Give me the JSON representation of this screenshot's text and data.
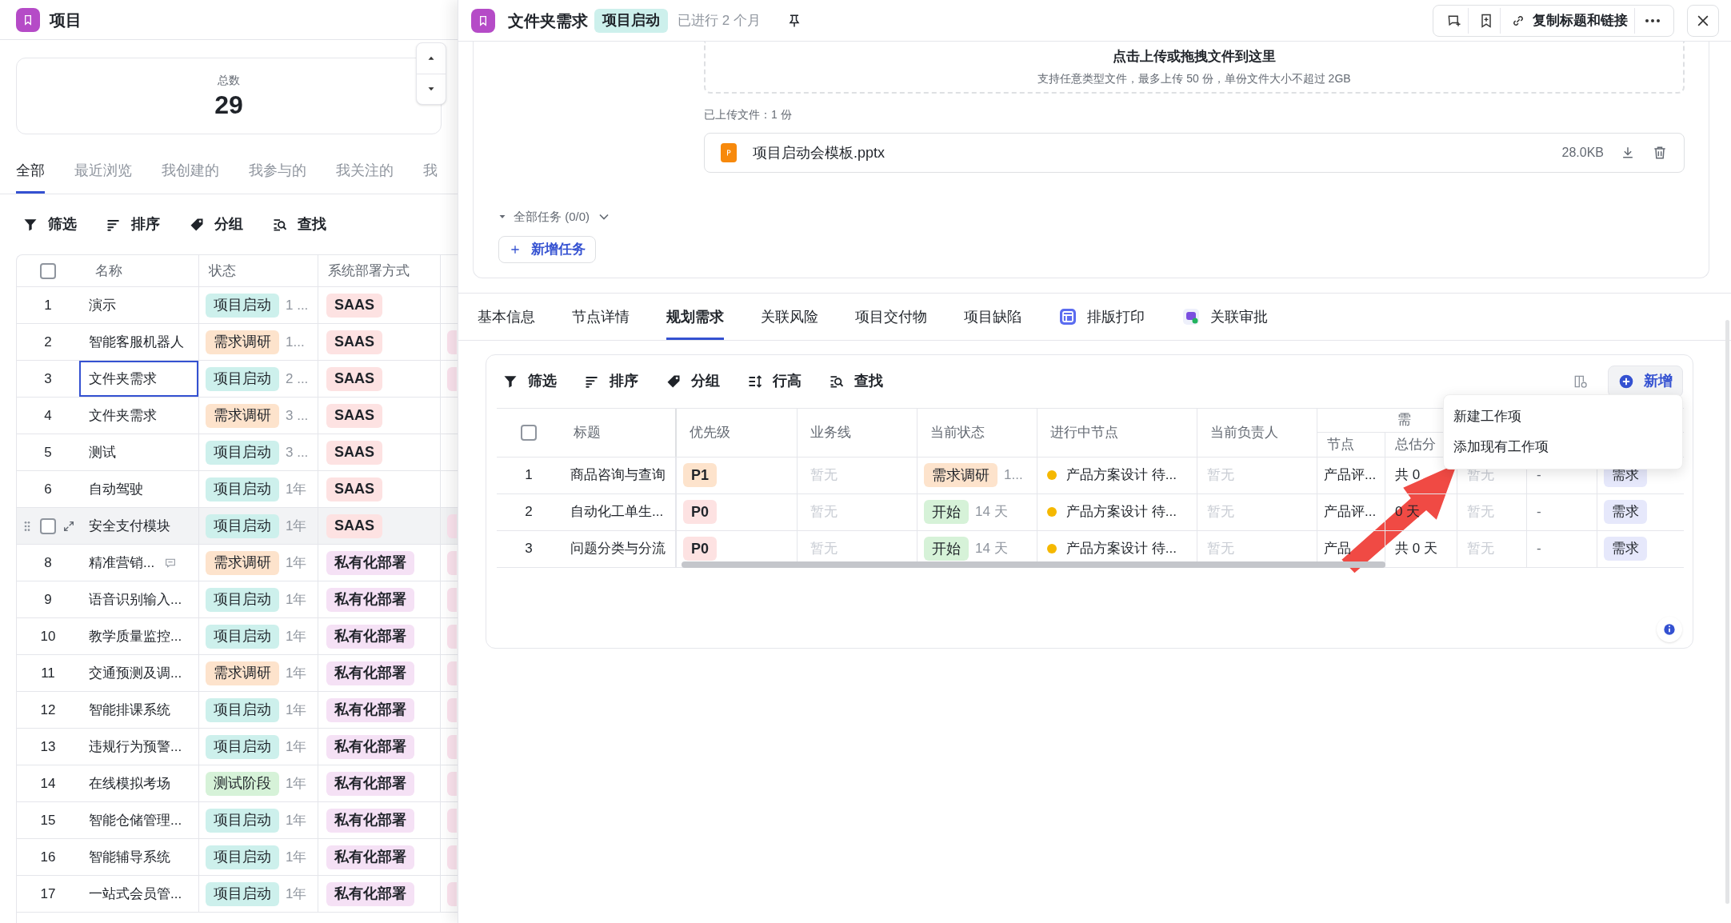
{
  "app": {
    "title": "项目"
  },
  "summary": {
    "label": "总数",
    "value": "29"
  },
  "list_tabs": [
    {
      "label": "全部",
      "selected": true
    },
    {
      "label": "最近浏览",
      "selected": false
    },
    {
      "label": "我创建的",
      "selected": false
    },
    {
      "label": "我参与的",
      "selected": false
    },
    {
      "label": "我关注的",
      "selected": false
    },
    {
      "label": "我",
      "selected": false
    }
  ],
  "left_toolbar": [
    {
      "kind": "filter",
      "label": "筛选"
    },
    {
      "kind": "sort",
      "label": "排序"
    },
    {
      "kind": "group",
      "label": "分组"
    },
    {
      "kind": "find",
      "label": "查找"
    }
  ],
  "project_table": {
    "select_all_checked": false,
    "columns": [
      "名称",
      "状态",
      "系统部署方式"
    ],
    "rows": [
      {
        "index": "1",
        "name": "演示",
        "status": {
          "label": "项目启动",
          "color": "#cdf0ec"
        },
        "duration": "1 ...",
        "deployment": {
          "label": "SAAS",
          "color": "#fde2e2"
        }
      },
      {
        "index": "2",
        "name": "智能客服机器人",
        "status": {
          "label": "需求调研",
          "color": "#fde3cc"
        },
        "duration": "1...",
        "deployment": {
          "label": "SAAS",
          "color": "#fde2e2"
        },
        "column_4": {
          "kind": "tag"
        }
      },
      {
        "index": "3",
        "name": "文件夹需求",
        "focused": true,
        "status": {
          "label": "项目启动",
          "color": "#cdf0ec"
        },
        "duration": "2 ...",
        "deployment": {
          "label": "SAAS",
          "color": "#fde2e2"
        },
        "column_4": {
          "kind": "tag"
        }
      },
      {
        "index": "4",
        "name": "文件夹需求",
        "status": {
          "label": "需求调研",
          "color": "#fde3cc"
        },
        "duration": "3 ...",
        "deployment": {
          "label": "SAAS",
          "color": "#fde2e2"
        }
      },
      {
        "index": "5",
        "name": "测试",
        "status": {
          "label": "项目启动",
          "color": "#cdf0ec"
        },
        "duration": "3 ...",
        "deployment": {
          "label": "SAAS",
          "color": "#fde2e2"
        }
      },
      {
        "index": "6",
        "name": "自动驾驶",
        "status": {
          "label": "项目启动",
          "color": "#cdf0ec"
        },
        "duration": "1年",
        "deployment": {
          "label": "SAAS",
          "color": "#fde2e2"
        }
      },
      {
        "hovered": true,
        "checked": false,
        "name": "安全支付模块",
        "status": {
          "label": "项目启动",
          "color": "#cdf0ec"
        },
        "duration": "1年",
        "deployment": {
          "label": "SAAS",
          "color": "#fde2e2"
        },
        "column_4": {
          "kind": "tag"
        }
      },
      {
        "index": "8",
        "name": "精准营销...",
        "comment": true,
        "status": {
          "label": "需求调研",
          "color": "#fde3cc"
        },
        "duration": "1年",
        "deployment": {
          "label": "私有化部署",
          "color": "#f5e1f5"
        },
        "column_4": {
          "kind": "tag"
        }
      },
      {
        "index": "9",
        "name": "语音识别输入...",
        "status": {
          "label": "项目启动",
          "color": "#cdf0ec"
        },
        "duration": "1年",
        "deployment": {
          "label": "私有化部署",
          "color": "#f5e1f5"
        },
        "column_4": {
          "kind": "tag"
        }
      },
      {
        "index": "10",
        "name": "教学质量监控...",
        "status": {
          "label": "项目启动",
          "color": "#cdf0ec"
        },
        "duration": "1年",
        "deployment": {
          "label": "私有化部署",
          "color": "#f5e1f5"
        },
        "column_4": {
          "kind": "tag"
        }
      },
      {
        "index": "11",
        "name": "交通预测及调...",
        "status": {
          "label": "需求调研",
          "color": "#fde3cc"
        },
        "duration": "1年",
        "deployment": {
          "label": "私有化部署",
          "color": "#f5e1f5"
        },
        "column_4": {
          "kind": "tag"
        }
      },
      {
        "index": "12",
        "name": "智能排课系统",
        "status": {
          "label": "项目启动",
          "color": "#cdf0ec"
        },
        "duration": "1年",
        "deployment": {
          "label": "私有化部署",
          "color": "#f5e1f5"
        },
        "column_4": {
          "kind": "tag"
        }
      },
      {
        "index": "13",
        "name": "违规行为预警...",
        "status": {
          "label": "项目启动",
          "color": "#cdf0ec"
        },
        "duration": "1年",
        "deployment": {
          "label": "私有化部署",
          "color": "#f5e1f5"
        },
        "column_4": {
          "kind": "tag"
        }
      },
      {
        "index": "14",
        "name": "在线模拟考场",
        "status": {
          "label": "测试阶段",
          "color": "#d6f2d8"
        },
        "duration": "1年",
        "deployment": {
          "label": "私有化部署",
          "color": "#f5e1f5"
        },
        "column_4": {
          "kind": "tag"
        }
      },
      {
        "index": "15",
        "name": "智能仓储管理...",
        "status": {
          "label": "项目启动",
          "color": "#cdf0ec"
        },
        "duration": "1年",
        "deployment": {
          "label": "私有化部署",
          "color": "#f5e1f5"
        },
        "column_4": {
          "kind": "tag"
        }
      },
      {
        "index": "16",
        "name": "智能辅导系统",
        "status": {
          "label": "项目启动",
          "color": "#cdf0ec"
        },
        "duration": "1年",
        "deployment": {
          "label": "私有化部署",
          "color": "#f5e1f5"
        },
        "column_4": {
          "kind": "tag"
        }
      },
      {
        "index": "17",
        "name": "一站式会员管...",
        "status": {
          "label": "项目启动",
          "color": "#cdf0ec"
        },
        "duration": "1年",
        "deployment": {
          "label": "私有化部署",
          "color": "#f5e1f5"
        },
        "column_4": {
          "kind": "tag"
        }
      }
    ]
  },
  "detail": {
    "title": "文件夹需求",
    "status": "项目启动",
    "elapsed": "已进行 2 个月",
    "copy_link": "复制标题和链接"
  },
  "upload": {
    "title": "点击上传或拖拽文件到这里",
    "hint": "支持任意类型文件，最多上传 50 份，单份文件大小不超过 2GB",
    "uploaded": "已上传文件：1 份",
    "files": [
      {
        "name": "项目启动会模板.pptx",
        "size": "28.0KB"
      }
    ]
  },
  "tasks": {
    "label": "全部任务 (0/0)",
    "add_button": "新增任务"
  },
  "detail_tabs": [
    {
      "label": "基本信息",
      "kind": "text",
      "selected": false
    },
    {
      "label": "节点详情",
      "kind": "text",
      "selected": false
    },
    {
      "label": "规划需求",
      "kind": "text",
      "selected": true
    },
    {
      "label": "关联风险",
      "kind": "text",
      "selected": false
    },
    {
      "label": "项目交付物",
      "kind": "text",
      "selected": false
    },
    {
      "label": "项目缺陷",
      "kind": "text",
      "selected": false
    },
    {
      "label": "排版打印",
      "kind": "layout",
      "selected": false
    },
    {
      "label": "关联审批",
      "kind": "approval",
      "selected": false
    }
  ],
  "req_toolbar": [
    {
      "kind": "filter",
      "label": "筛选"
    },
    {
      "kind": "sort",
      "label": "排序"
    },
    {
      "kind": "group",
      "label": "分组"
    },
    {
      "kind": "height",
      "label": "行高"
    },
    {
      "kind": "find",
      "label": "查找"
    }
  ],
  "add_button": "新增",
  "req_table": {
    "select_all_checked": false,
    "columns": [
      "标题",
      "优先级",
      "业务线",
      "当前状态",
      "进行中节点",
      "当前负责人"
    ],
    "group": {
      "label": "需",
      "columns": [
        "节点",
        "总估分"
      ]
    },
    "rows": [
      {
        "index": "1",
        "title": "商品咨询与查询",
        "priority": {
          "label": "P1",
          "color": "#fde3cc"
        },
        "business_line": "暂无",
        "status": {
          "label": "需求调研",
          "color": "#fde3cc"
        },
        "status_age": "1...",
        "node": "产品方案设计 待...",
        "owner": "暂无",
        "stage_node": "产品评...",
        "estimate": "共 0",
        "column_9": "暂无",
        "column_10": "-",
        "type": "需求"
      },
      {
        "index": "2",
        "title": "自动化工单生...",
        "priority": {
          "label": "P0",
          "color": "#fde2e2"
        },
        "business_line": "暂无",
        "status": {
          "label": "开始",
          "color": "#d6f2d8"
        },
        "status_age": "14 天",
        "node": "产品方案设计 待...",
        "owner": "暂无",
        "stage_node": "产品评...",
        "estimate": "0 天",
        "column_9": "暂无",
        "column_10": "-",
        "type": "需求"
      },
      {
        "index": "3",
        "title": "问题分类与分流",
        "priority": {
          "label": "P0",
          "color": "#fde2e2"
        },
        "business_line": "暂无",
        "status": {
          "label": "开始",
          "color": "#d6f2d8"
        },
        "status_age": "14 天",
        "node": "产品方案设计 待...",
        "owner": "暂无",
        "stage_node": "产品",
        "estimate": "共 0 天",
        "column_9": "暂无",
        "column_10": "-",
        "type": "需求"
      }
    ]
  },
  "menu": [
    "新建工作项",
    "添加现有工作项"
  ]
}
